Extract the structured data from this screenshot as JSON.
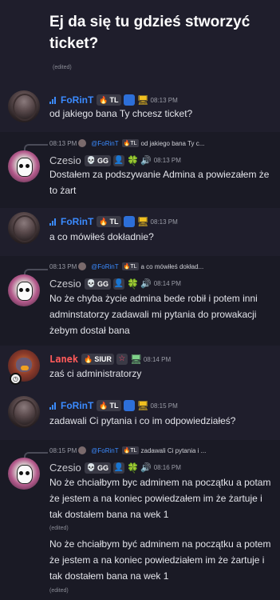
{
  "thread": {
    "title": "Ej da się tu gdzieś stworzyć ticket?",
    "edited_label": "(edited)"
  },
  "users": {
    "forint": {
      "name": "FoRinT",
      "tag": "TL"
    },
    "czesio": {
      "name": "Czesio",
      "tag": "GG"
    },
    "lanek": {
      "name": "Lanek",
      "tag": "SIUR"
    }
  },
  "messages": [
    {
      "time": "08:13 PM",
      "text": "od jakiego bana Ty chcesz ticket?"
    },
    {
      "reply_time": "08:13 PM",
      "reply_name": "@FoRinT",
      "reply_tag": "TL",
      "reply_text": "od jakiego bana Ty c...",
      "time": "08:13 PM",
      "text": "Dostałem za podszywanie Admina a powiezałem że to żart"
    },
    {
      "time": "08:13 PM",
      "text": "a co mówiłeś dokładnie?"
    },
    {
      "reply_time": "08:13 PM",
      "reply_name": "@FoRinT",
      "reply_tag": "TL",
      "reply_text": "a co mówiłeś dokład...",
      "time": "08:14 PM",
      "text": "No że chyba życie admina bede robił i potem inni adminstatorzy zadawali mi pytania do prowakacji żebym dostał bana"
    },
    {
      "time": "08:14 PM",
      "text": "zaś ci administratorzy"
    },
    {
      "time": "08:15 PM",
      "text": "zadawali Ci pytania i co im odpowiedziałeś?"
    },
    {
      "reply_time": "08:15 PM",
      "reply_name": "@FoRinT",
      "reply_tag": "TL",
      "reply_text": "zadawali Ci pytania i ...",
      "time": "08:16 PM",
      "text": "No że chciałbym byc adminem na początku a potam że jestem a na koniec powiedzałem im że żartuje i tak dostałem bana na wek 1",
      "text2": "No że chciałbym być adminem na początku a potem że jestem a na koniec powiedziałem im że żartuje i tak dostałem bana na wek 1"
    }
  ],
  "colors": {
    "background": "#1f1e2c",
    "forint": "#3b8bff",
    "lanek": "#ff5a5a",
    "text": "#e3e4ea"
  }
}
